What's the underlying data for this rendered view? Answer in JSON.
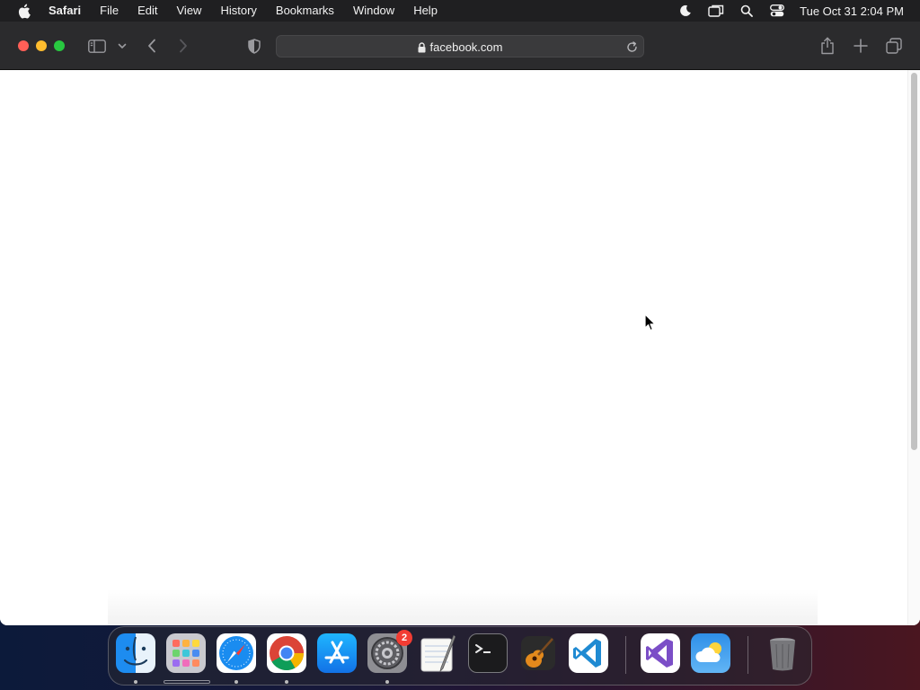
{
  "menubar": {
    "app_name": "Safari",
    "items": [
      "File",
      "Edit",
      "View",
      "History",
      "Bookmarks",
      "Window",
      "Help"
    ],
    "status_icons": [
      "moon-icon",
      "screen-mirroring-icon",
      "spotlight-search-icon",
      "control-center-icon"
    ],
    "clock": "Tue Oct 31  2:04 PM"
  },
  "safari": {
    "address": "facebook.com",
    "toolbar_icons": [
      "sidebar-icon",
      "chevron-down-icon",
      "back-icon",
      "forward-icon",
      "privacy-shield-icon",
      "share-icon",
      "new-tab-icon",
      "tab-overview-icon"
    ]
  },
  "dock": {
    "apps": [
      "Finder",
      "Launchpad",
      "Safari",
      "Google Chrome",
      "App Store",
      "System Settings",
      "TextEdit",
      "Terminal",
      "GarageBand",
      "Visual Studio Code",
      "Visual Studio",
      "Weather",
      "Trash"
    ],
    "system_settings_badge": "2"
  },
  "colors": {
    "close": "#ff5f57",
    "minimize": "#febc2e",
    "maximize": "#28c840",
    "menubar": "#1f1f21",
    "toolbar": "#2b2b2d"
  }
}
